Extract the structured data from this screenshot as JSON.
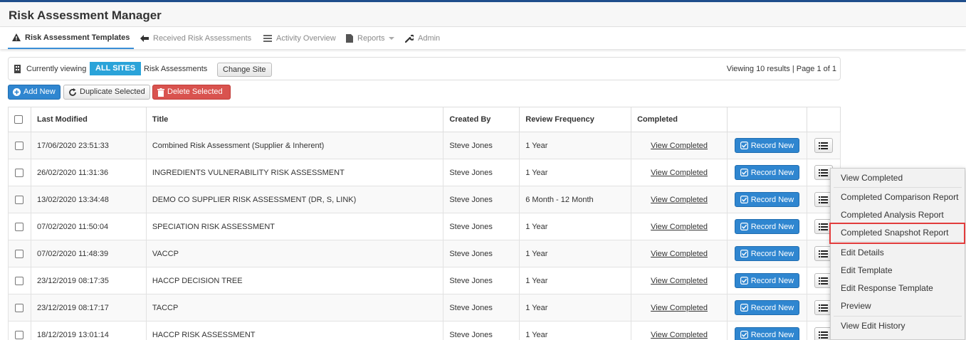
{
  "app": {
    "title": "Risk Assessment Manager"
  },
  "nav": [
    {
      "label": "Risk Assessment Templates",
      "icon": "warning-icon",
      "active": true
    },
    {
      "label": "Received Risk Assessments",
      "icon": "arrow-left-icon",
      "active": false
    },
    {
      "label": "Activity Overview",
      "icon": "list-icon",
      "active": false
    },
    {
      "label": "Reports",
      "icon": "file-icon",
      "active": false
    },
    {
      "label": "Admin",
      "icon": "wrench-icon",
      "active": false
    }
  ],
  "viewbar": {
    "label": "Currently viewing",
    "badge": "ALL SITES",
    "after": "Risk Assessments",
    "change": "Change Site",
    "results": "Viewing 10 results | Page 1 of 1"
  },
  "actions": {
    "add": "Add New",
    "duplicate": "Duplicate Selected",
    "delete": "Delete Selected"
  },
  "table": {
    "headers": [
      "Last Modified",
      "Title",
      "Created By",
      "Review Frequency",
      "Completed"
    ],
    "view_label": "View Completed",
    "record_label": "Record New",
    "rows": [
      {
        "modified": "17/06/2020 23:51:33",
        "title": "Combined Risk Assessment (Supplier & Inherent)",
        "created_by": "Steve Jones",
        "frequency": "1 Year"
      },
      {
        "modified": "26/02/2020 11:31:36",
        "title": "INGREDIENTS VULNERABILITY RISK ASSESSMENT",
        "created_by": "Steve Jones",
        "frequency": "1 Year"
      },
      {
        "modified": "13/02/2020 13:34:48",
        "title": "DEMO CO SUPPLIER RISK ASSESSMENT (DR, S, LINK)",
        "created_by": "Steve Jones",
        "frequency": "6 Month - 12 Month"
      },
      {
        "modified": "07/02/2020 11:50:04",
        "title": "SPECIATION RISK ASSESSMENT",
        "created_by": "Steve Jones",
        "frequency": "1 Year"
      },
      {
        "modified": "07/02/2020 11:48:39",
        "title": "VACCP",
        "created_by": "Steve Jones",
        "frequency": "1 Year"
      },
      {
        "modified": "23/12/2019 08:17:35",
        "title": "HACCP DECISION TREE",
        "created_by": "Steve Jones",
        "frequency": "1 Year"
      },
      {
        "modified": "23/12/2019 08:17:17",
        "title": "TACCP",
        "created_by": "Steve Jones",
        "frequency": "1 Year"
      },
      {
        "modified": "18/12/2019 13:01:14",
        "title": "HACCP RISK ASSESSMENT",
        "created_by": "Steve Jones",
        "frequency": "1 Year"
      }
    ]
  },
  "menu": {
    "items": [
      "View Completed",
      "Completed Comparison Report",
      "Completed Analysis Report",
      "Completed Snapshot Report",
      "Edit Details",
      "Edit Template",
      "Edit Response Template",
      "Preview",
      "View Edit History"
    ]
  },
  "colors": {
    "accent": "#2f86d0",
    "badge": "#2aa3d9",
    "danger": "#d9534f",
    "highlight": "#e23c3c",
    "topbar": "#1f4e8c"
  }
}
